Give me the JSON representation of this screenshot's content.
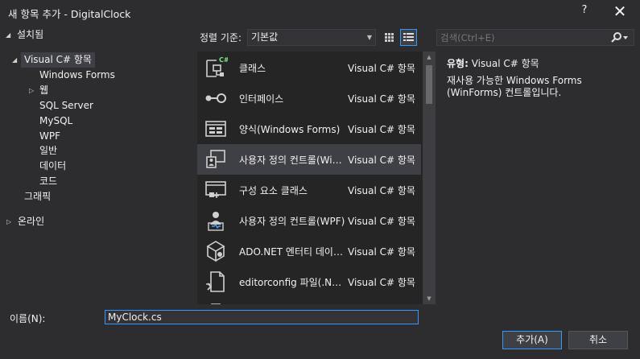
{
  "window": {
    "title": "새 항목 추가 - DigitalClock",
    "help": "?",
    "close": "✕"
  },
  "tree": {
    "installed": "설치됨",
    "visual_csharp": "Visual C# 항목",
    "children": [
      "Windows Forms",
      "웹",
      "SQL Server",
      "MySQL",
      "WPF",
      "일반",
      "데이터",
      "코드"
    ],
    "graphics": "그래픽",
    "online": "온라인"
  },
  "toolbar": {
    "sort_label": "정렬 기준:",
    "sort_value": "기본값",
    "search_placeholder": "검색(Ctrl+E)"
  },
  "items": [
    {
      "name": "클래스",
      "category": "Visual C# 항목",
      "icon": "class-icon"
    },
    {
      "name": "인터페이스",
      "category": "Visual C# 항목",
      "icon": "interface-icon"
    },
    {
      "name": "양식(Windows Forms)",
      "category": "Visual C# 항목",
      "icon": "form-icon"
    },
    {
      "name": "사용자 정의 컨트롤(Windows Forms)",
      "category": "Visual C# 항목",
      "icon": "user-control-icon"
    },
    {
      "name": "구성 요소 클래스",
      "category": "Visual C# 항목",
      "icon": "component-icon"
    },
    {
      "name": "사용자 정의 컨트롤(WPF)",
      "category": "Visual C# 항목",
      "icon": "wpf-user-control-icon"
    },
    {
      "name": "ADO.NET 엔터티 데이터 모델",
      "category": "Visual C# 항목",
      "icon": "ado-net-icon"
    },
    {
      "name": "editorconfig 파일(.NET)",
      "category": "Visual C# 항목",
      "icon": "editorconfig-icon"
    }
  ],
  "details": {
    "type_label": "유형:",
    "type_value": "Visual C# 항목",
    "description": "재사용 가능한 Windows Forms (WinForms) 컨트롤입니다."
  },
  "bottom": {
    "name_label": "이름(N):",
    "name_value": "MyClock.cs",
    "add_button": "추가(A)",
    "cancel_button": "취소"
  }
}
